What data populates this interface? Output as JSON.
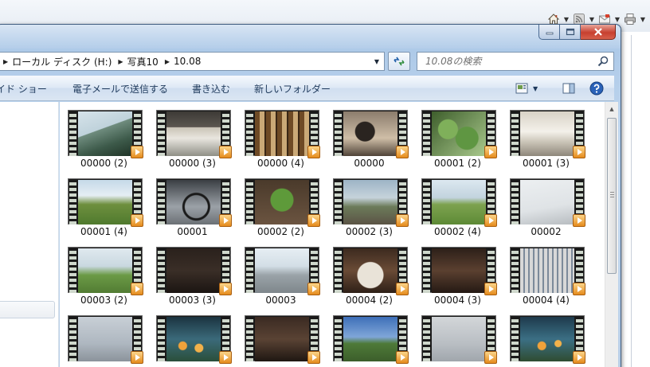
{
  "background_browser": {
    "icons": [
      "home-icon",
      "rss-feed-icon",
      "mail-icon",
      "printer-icon"
    ]
  },
  "window": {
    "caption_buttons": [
      "minimize",
      "maximize",
      "close"
    ]
  },
  "address_bar": {
    "crumbs": [
      {
        "label": "ローカル ディスク (H:)"
      },
      {
        "label": "写真10"
      },
      {
        "label": "10.08"
      }
    ]
  },
  "search": {
    "placeholder": "10.08の検索"
  },
  "command_bar": {
    "items": [
      {
        "label": "イド ショー"
      },
      {
        "label": "電子メールで送信する"
      },
      {
        "label": "書き込む"
      },
      {
        "label": "新しいフォルダー"
      }
    ]
  },
  "files": [
    {
      "label": "00000 (2)",
      "photo": "mantis-on-railing"
    },
    {
      "label": "00000 (3)",
      "photo": "living-room-sofa"
    },
    {
      "label": "00000 (4)",
      "photo": "bookshelf-room"
    },
    {
      "label": "00000",
      "photo": "child-in-room"
    },
    {
      "label": "00001 (2)",
      "photo": "green-leaves"
    },
    {
      "label": "00001 (3)",
      "photo": "bright-room"
    },
    {
      "label": "00001 (4)",
      "photo": "park-lawn-tent"
    },
    {
      "label": "00001",
      "photo": "bicycle-wheel"
    },
    {
      "label": "00002 (2)",
      "photo": "plant-on-soil"
    },
    {
      "label": "00002 (3)",
      "photo": "girl-with-camera"
    },
    {
      "label": "00002 (4)",
      "photo": "person-on-lawn"
    },
    {
      "label": "00002",
      "photo": "telescope"
    },
    {
      "label": "00003 (2)",
      "photo": "people-in-park"
    },
    {
      "label": "00003 (3)",
      "photo": "dark-room"
    },
    {
      "label": "00003",
      "photo": "parking-lot-bus"
    },
    {
      "label": "00004 (2)",
      "photo": "dinner-table"
    },
    {
      "label": "00004 (3)",
      "photo": "dim-restaurant"
    },
    {
      "label": "00004 (4)",
      "photo": "playground-frame"
    },
    {
      "label": "",
      "photo": "sky-pole"
    },
    {
      "label": "",
      "photo": "aquarium-fish"
    },
    {
      "label": "",
      "photo": "dark-event"
    },
    {
      "label": "",
      "photo": "outdoor-crowd"
    },
    {
      "label": "",
      "photo": "overcast-sky"
    },
    {
      "label": "",
      "photo": "aquarium-fish-2"
    }
  ]
}
